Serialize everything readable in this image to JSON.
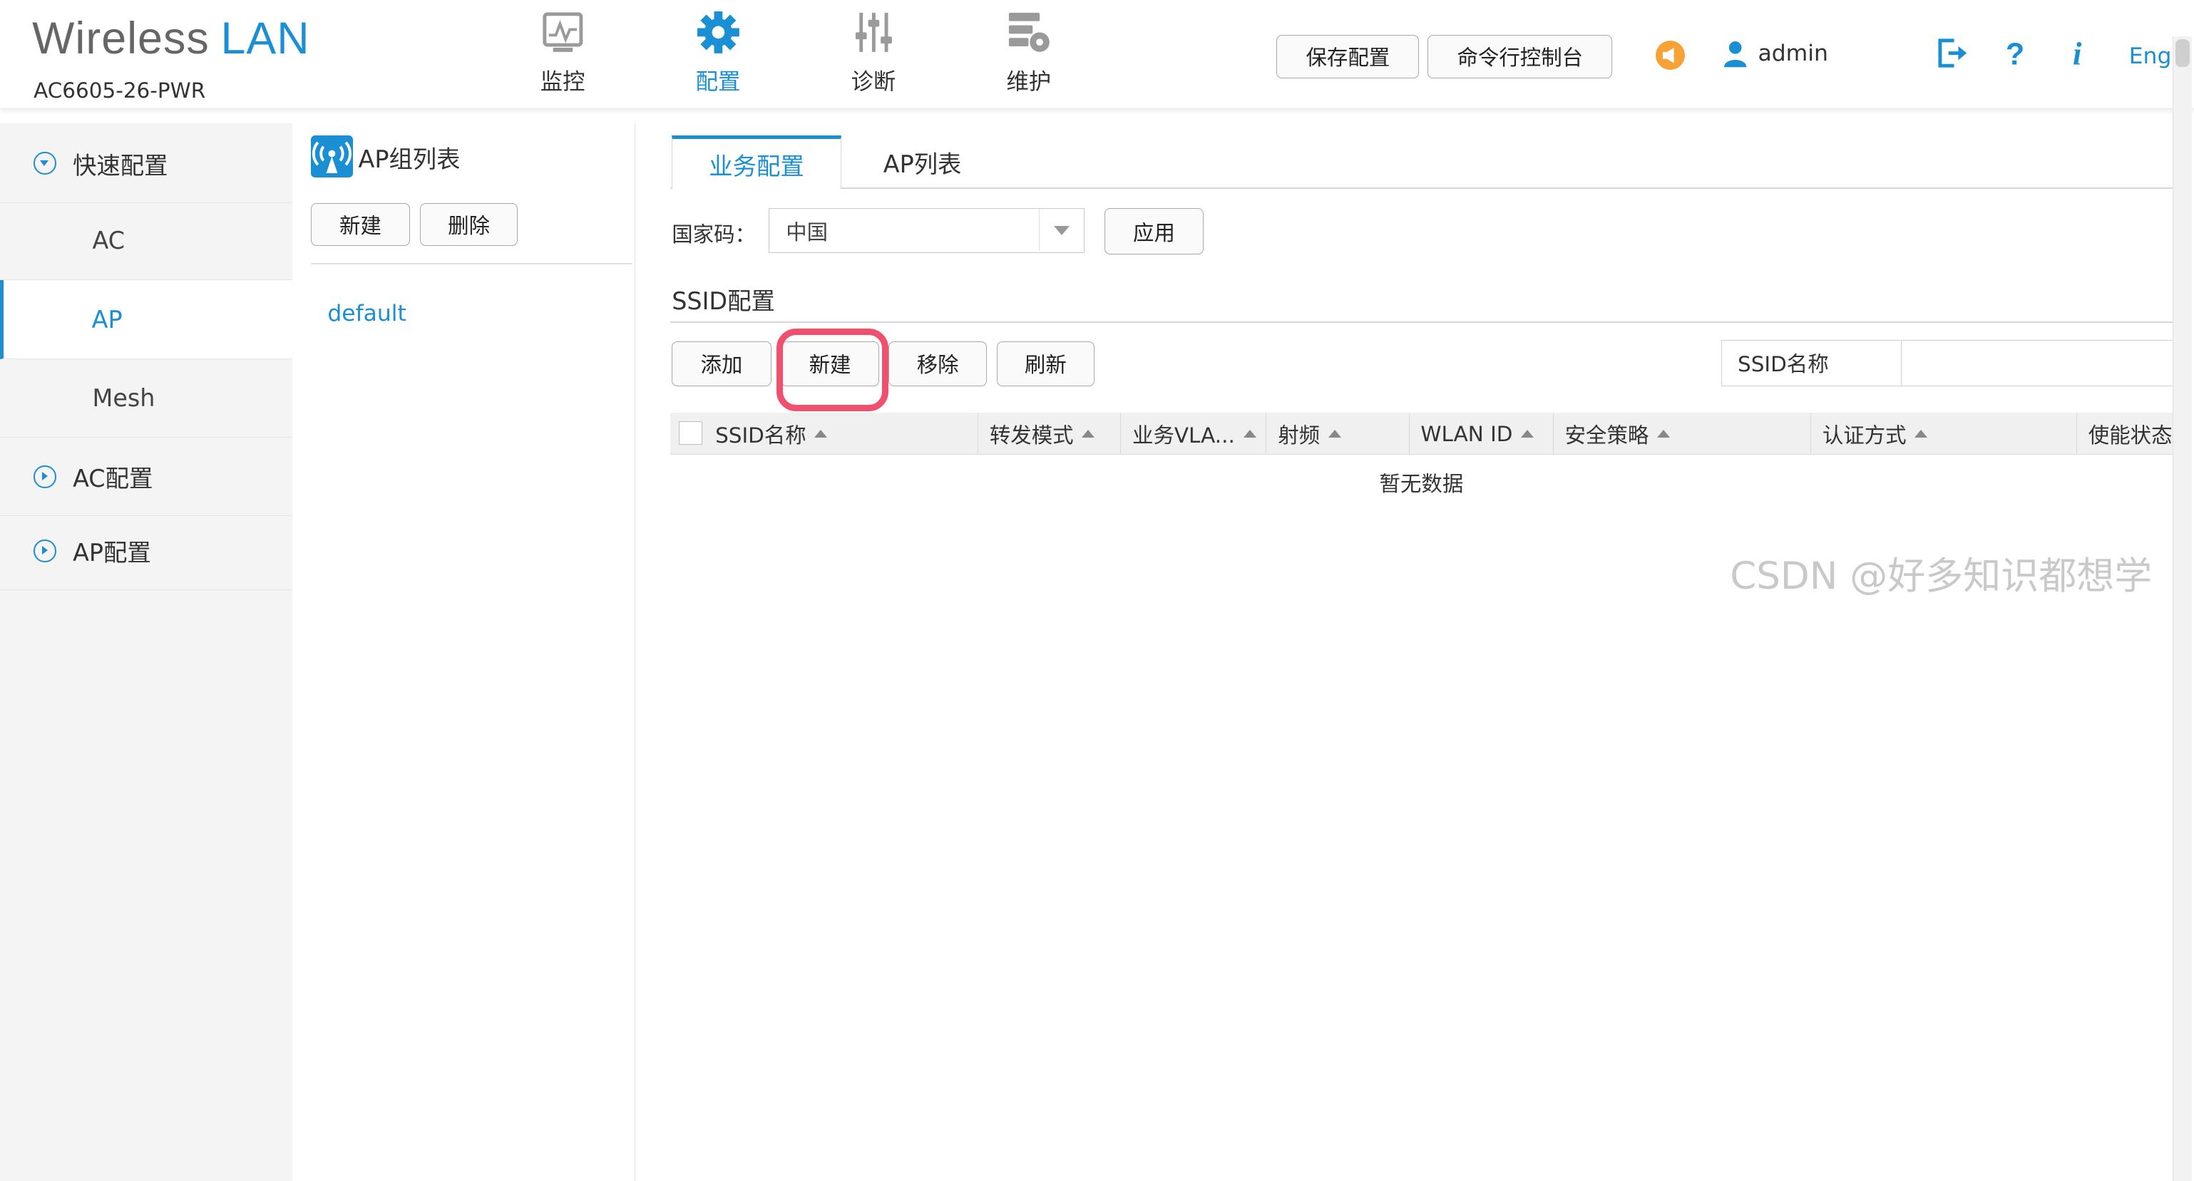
{
  "header": {
    "brand_part1": "Wireless",
    "brand_part2": "LAN",
    "model": "AC6605-26-PWR",
    "nav": [
      {
        "label": "监控",
        "icon": "monitor-icon",
        "active": false
      },
      {
        "label": "配置",
        "icon": "gear-icon",
        "active": true
      },
      {
        "label": "诊断",
        "icon": "sliders-icon",
        "active": false
      },
      {
        "label": "维护",
        "icon": "server-gear-icon",
        "active": false
      }
    ],
    "save_config_label": "保存配置",
    "cli_console_label": "命令行控制台",
    "username": "admin",
    "language_label": "Eng"
  },
  "sidebar": {
    "items": [
      {
        "label": "快速配置",
        "type": "group",
        "expanded": true
      },
      {
        "label": "AC",
        "type": "sub"
      },
      {
        "label": "AP",
        "type": "sub",
        "selected": true
      },
      {
        "label": "Mesh",
        "type": "sub"
      },
      {
        "label": "AC配置",
        "type": "group",
        "expanded": false
      },
      {
        "label": "AP配置",
        "type": "group",
        "expanded": false
      }
    ]
  },
  "ap_group_panel": {
    "title": "AP组列表",
    "new_label": "新建",
    "delete_label": "删除",
    "groups": [
      "default"
    ]
  },
  "main": {
    "tabs": [
      {
        "label": "业务配置",
        "active": true
      },
      {
        "label": "AP列表",
        "active": false
      }
    ],
    "country_code_label": "国家码：",
    "country_value": "中国",
    "apply_label": "应用",
    "ssid_section_title": "SSID配置",
    "toolbar": {
      "add_label": "添加",
      "new_label": "新建",
      "remove_label": "移除",
      "refresh_label": "刷新"
    },
    "search": {
      "label": "SSID名称",
      "value": ""
    },
    "table": {
      "columns": [
        "SSID名称",
        "转发模式",
        "业务VLA...",
        "射频",
        "WLAN ID",
        "安全策略",
        "认证方式",
        "使能状态"
      ],
      "empty_text": "暂无数据"
    }
  },
  "watermark": "CSDN @好多知识都想学",
  "colors": {
    "accent": "#1a8fd4",
    "highlight": "#f0506e",
    "bell": "#f7a234"
  }
}
